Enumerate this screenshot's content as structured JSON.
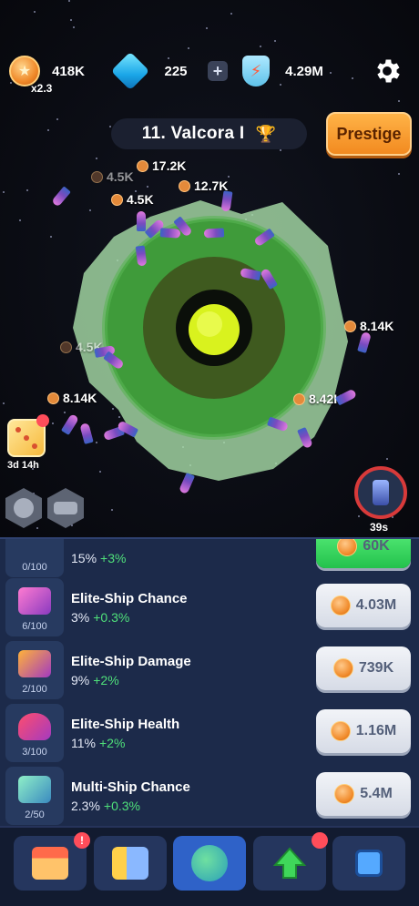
{
  "header": {
    "coins": {
      "value": "418K",
      "multiplier": "x2.3",
      "icon": "coin-icon"
    },
    "gems": {
      "value": "225",
      "icon": "gem-icon",
      "add_label": "+"
    },
    "shield": {
      "value": "4.29M",
      "icon": "shield-bolt-icon"
    },
    "settings_icon": "gear-icon"
  },
  "planet": {
    "title": "11. Valcora I",
    "trophy_icon": "trophy-icon",
    "prestige_label": "Prestige"
  },
  "floating_rewards": [
    {
      "value": "17.2K",
      "dim": false
    },
    {
      "value": "4.5K",
      "dim": true
    },
    {
      "value": "12.7K",
      "dim": false
    },
    {
      "value": "4.5K",
      "dim": false
    },
    {
      "value": "8.14K",
      "dim": false
    },
    {
      "value": "4.5K",
      "dim": true
    },
    {
      "value": "8.14K",
      "dim": false
    },
    {
      "value": "8.42K",
      "dim": false
    }
  ],
  "side": {
    "dice_timer": "3d 14h",
    "boost_timer": "39s"
  },
  "upgrades": [
    {
      "name": "",
      "level": "0/100",
      "base": "15%",
      "inc": "+3%",
      "cost": "60K",
      "affordable": true
    },
    {
      "name": "Elite-Ship Chance",
      "level": "6/100",
      "base": "3%",
      "inc": "+0.3%",
      "cost": "4.03M",
      "affordable": false
    },
    {
      "name": "Elite-Ship Damage",
      "level": "2/100",
      "base": "9%",
      "inc": "+2%",
      "cost": "739K",
      "affordable": false
    },
    {
      "name": "Elite-Ship Health",
      "level": "3/100",
      "base": "11%",
      "inc": "+2%",
      "cost": "1.16M",
      "affordable": false
    },
    {
      "name": "Multi-Ship Chance",
      "level": "2/50",
      "base": "2.3%",
      "inc": "+0.3%",
      "cost": "5.4M",
      "affordable": false
    }
  ],
  "nav": [
    {
      "icon": "shop-icon",
      "badge": "!"
    },
    {
      "icon": "ship-upgrade-icon",
      "badge": ""
    },
    {
      "icon": "planet-icon",
      "badge": "",
      "active": true
    },
    {
      "icon": "arrow-up-icon",
      "badge": ""
    },
    {
      "icon": "chip-icon",
      "badge": ""
    }
  ],
  "colors": {
    "accent_green": "#4fe07a",
    "prestige_orange": "#f28a20",
    "active_tab": "#2f62c8"
  }
}
